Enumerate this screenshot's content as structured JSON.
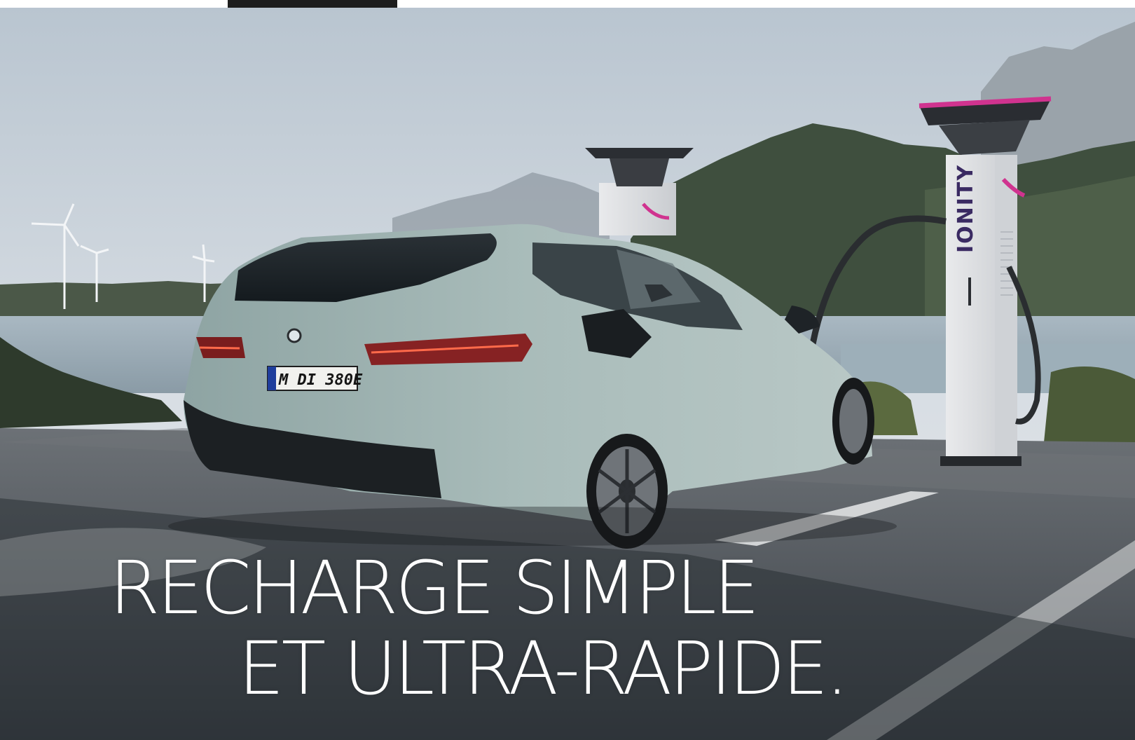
{
  "hero": {
    "headline_line_1": "RECHARGE SIMPLE",
    "headline_line_2": "ET ULTRA-RAPIDE.",
    "license_plate": "M DI 380E",
    "charger_brand": "IONITY"
  },
  "colors": {
    "sky": "#c9d3dc",
    "car_body": "#9fb3b1",
    "charger_accent": "#d0338f",
    "asphalt": "#4a4f55",
    "text": "#ffffff",
    "tab": "#1d1d1d"
  }
}
